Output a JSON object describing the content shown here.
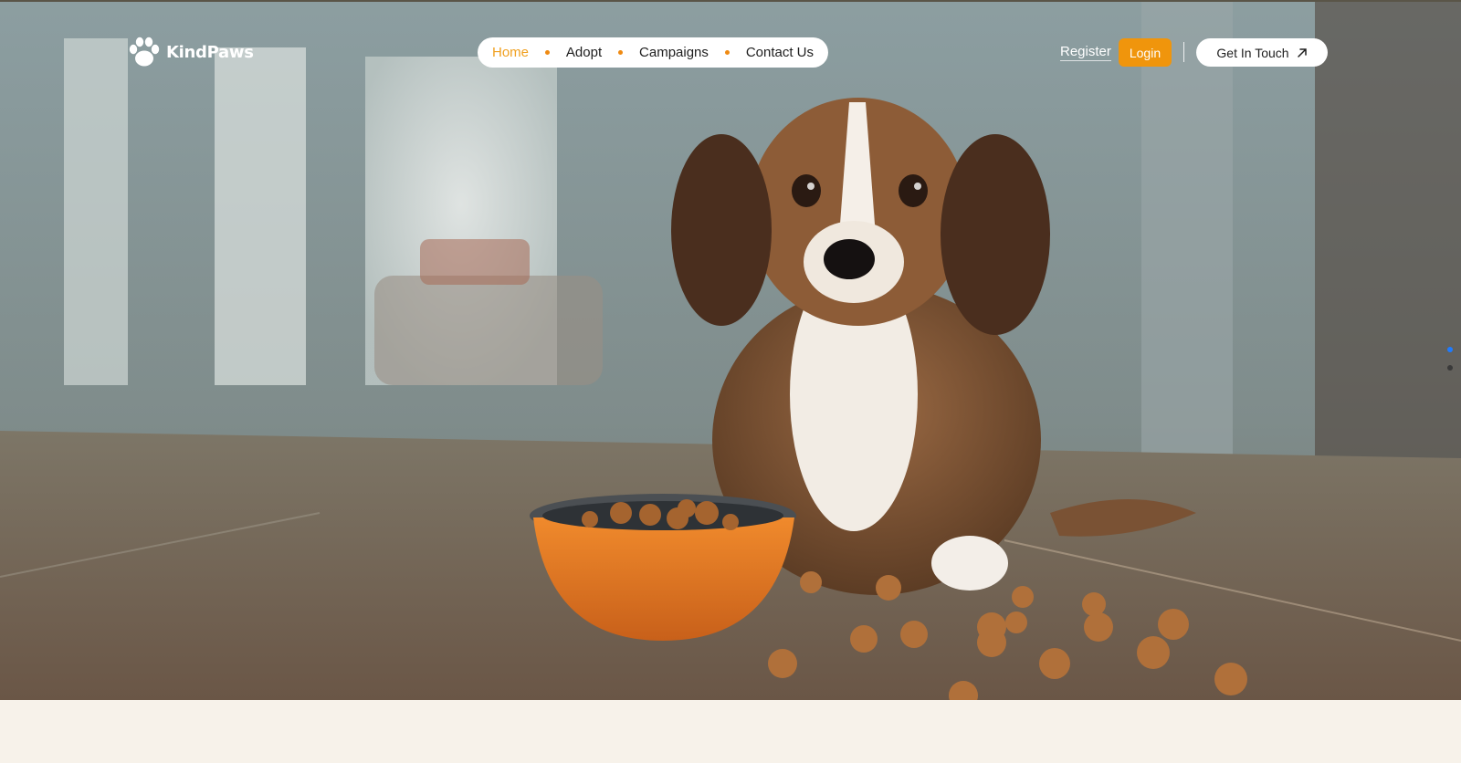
{
  "brand": {
    "name": "KindPaws",
    "logo_icon": "paw-icon"
  },
  "nav": {
    "items": [
      {
        "label": "Home",
        "active": true
      },
      {
        "label": "Adopt",
        "active": false
      },
      {
        "label": "Campaigns",
        "active": false
      },
      {
        "label": "Contact Us",
        "active": false
      }
    ]
  },
  "auth": {
    "register_label": "Register",
    "login_label": "Login"
  },
  "cta": {
    "label": "Get In Touch",
    "icon": "arrow-up-right-icon"
  },
  "hero": {
    "image_alt": "",
    "pager": {
      "count": 2,
      "active_index": 0
    }
  },
  "colors": {
    "accent": "#f0950c",
    "nav_active": "#f0a020",
    "nav_dot": "#ef8a12",
    "pager_active": "#1e7bff",
    "footer_bg": "#f7f2ea"
  }
}
